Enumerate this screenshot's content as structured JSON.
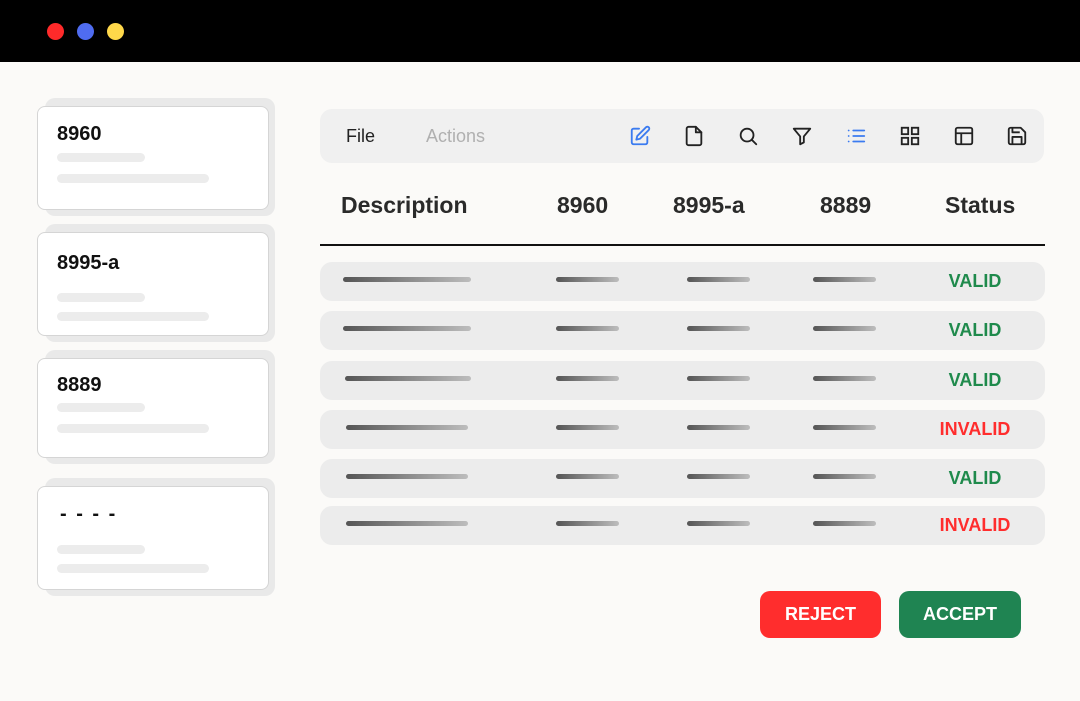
{
  "cards": [
    {
      "title": "8960"
    },
    {
      "title": "8995-a"
    },
    {
      "title": "8889"
    },
    {
      "title": "- - - -"
    }
  ],
  "toolbar": {
    "menu": {
      "file": "File",
      "actions": "Actions"
    },
    "icons": [
      "edit-icon",
      "document-icon",
      "search-icon",
      "filter-icon",
      "list-view-icon",
      "grid-view-icon",
      "layout-icon",
      "save-icon"
    ]
  },
  "table": {
    "headers": [
      "Description",
      "8960",
      "8995-a",
      "8889",
      "Status"
    ],
    "rows": [
      {
        "status": "VALID"
      },
      {
        "status": "VALID"
      },
      {
        "status": "VALID"
      },
      {
        "status": "INVALID"
      },
      {
        "status": "VALID"
      },
      {
        "status": "INVALID"
      }
    ]
  },
  "colors": {
    "valid": "#1f8a4c",
    "invalid": "#ff2d2d",
    "active_icon": "#3b7bf0"
  },
  "buttons": {
    "reject": "REJECT",
    "accept": "ACCEPT"
  }
}
